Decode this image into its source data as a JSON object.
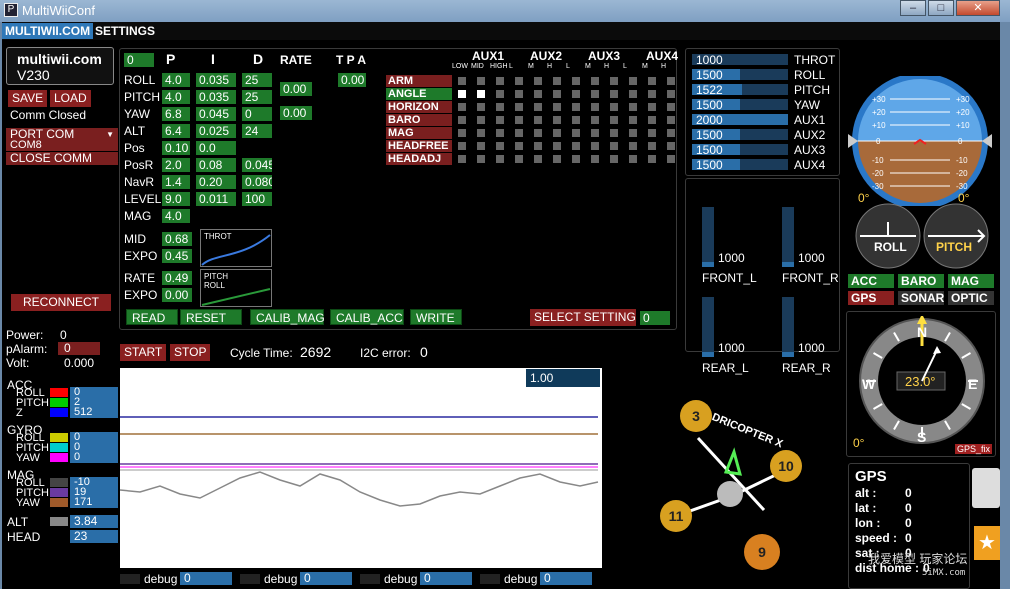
{
  "window": {
    "title": "MultiWiiConf",
    "icon": "P"
  },
  "menu": {
    "multiwii": "MULTIWII.COM",
    "settings": "SETTINGS"
  },
  "brand": {
    "line1": "multiwii.com",
    "line2": "V230"
  },
  "left": {
    "save": "SAVE",
    "load": "LOAD",
    "comm_status": "Comm Closed",
    "port_com": "PORT COM",
    "com8": "COM8",
    "close_comm": "CLOSE COMM",
    "reconnect": "RECONNECT",
    "power_label": "Power:",
    "power_val": "0",
    "palarm_label": "pAlarm:",
    "palarm_val": "0",
    "volt_label": "Volt:",
    "volt_val": "0.000"
  },
  "pid": {
    "header_num": "0",
    "col_p": "P",
    "col_i": "I",
    "col_d": "D",
    "col_rate": "RATE",
    "col_tpa": "T P A",
    "tpa_val": "0.00",
    "rows": [
      {
        "name": "ROLL",
        "p": "4.0",
        "i": "0.035",
        "d": "25"
      },
      {
        "name": "PITCH",
        "p": "4.0",
        "i": "0.035",
        "d": "25"
      },
      {
        "name": "YAW",
        "p": "6.8",
        "i": "0.045",
        "d": "0"
      },
      {
        "name": "ALT",
        "p": "6.4",
        "i": "0.025",
        "d": "24"
      },
      {
        "name": "Pos",
        "p": "0.10",
        "i": "0.0",
        "d": ""
      },
      {
        "name": "PosR",
        "p": "2.0",
        "i": "0.08",
        "d": "0.045"
      },
      {
        "name": "NavR",
        "p": "1.4",
        "i": "0.20",
        "d": "0.080"
      },
      {
        "name": "LEVEL",
        "p": "9.0",
        "i": "0.011",
        "d": "100"
      },
      {
        "name": "MAG",
        "p": "4.0",
        "i": "",
        "d": ""
      }
    ],
    "rate_roll_pitch": "0.00",
    "rate_yaw": "0.00",
    "mid_label": "MID",
    "mid_val": "0.68",
    "expo_label": "EXPO",
    "expo_val": "0.45",
    "rate_label": "RATE",
    "rate_val": "0.49",
    "expo2_label": "EXPO",
    "expo2_val": "0.00",
    "throt_graph_label": "THROT",
    "pitchroll_graph_label1": "PITCH",
    "pitchroll_graph_label2": "ROLL"
  },
  "actions": {
    "read": "READ",
    "reset": "RESET",
    "calib_mag": "CALIB_MAG",
    "calib_acc": "CALIB_ACC",
    "write": "WRITE",
    "select_setting": "SELECT SETTING",
    "setting_val": "0"
  },
  "aux": {
    "headers": [
      "AUX1",
      "AUX2",
      "AUX3",
      "AUX4"
    ],
    "sub1": [
      "LOW",
      "MID",
      "HIGH"
    ],
    "sub": [
      "L",
      "M",
      "H"
    ],
    "boxes": [
      {
        "name": "ARM",
        "active": false,
        "on": []
      },
      {
        "name": "ANGLE",
        "active": true,
        "on": [
          0,
          1
        ]
      },
      {
        "name": "HORIZON",
        "active": false,
        "on": []
      },
      {
        "name": "BARO",
        "active": false,
        "on": []
      },
      {
        "name": "MAG",
        "active": false,
        "on": []
      },
      {
        "name": "HEADFREE",
        "active": false,
        "on": []
      },
      {
        "name": "HEADADJ",
        "active": false,
        "on": []
      }
    ]
  },
  "rc": [
    {
      "name": "THROT",
      "value": "1000",
      "level": 0.0
    },
    {
      "name": "ROLL",
      "value": "1500",
      "level": 0.5
    },
    {
      "name": "PITCH",
      "value": "1522",
      "level": 0.52
    },
    {
      "name": "YAW",
      "value": "1500",
      "level": 0.5
    },
    {
      "name": "AUX1",
      "value": "2000",
      "level": 1.0
    },
    {
      "name": "AUX2",
      "value": "1500",
      "level": 0.5
    },
    {
      "name": "AUX3",
      "value": "1500",
      "level": 0.5
    },
    {
      "name": "AUX4",
      "value": "1500",
      "level": 0.5
    }
  ],
  "motors": [
    {
      "name": "FRONT_L",
      "value": "1000",
      "level": 0.08
    },
    {
      "name": "FRONT_R",
      "value": "1000",
      "level": 0.08
    },
    {
      "name": "REAR_L",
      "value": "1000",
      "level": 0.08
    },
    {
      "name": "REAR_R",
      "value": "1000",
      "level": 0.08
    }
  ],
  "horizon": {
    "ticks_pos": [
      "+30",
      "+20",
      "+10"
    ],
    "ticks_neg": [
      "-10",
      "-20",
      "-30"
    ],
    "zero": "0",
    "roll_angle": "0°",
    "pitch_angle": "0°",
    "roll_label": "ROLL",
    "pitch_label": "PITCH"
  },
  "sensors": [
    {
      "name": "ACC",
      "state": "g"
    },
    {
      "name": "BARO",
      "state": "g"
    },
    {
      "name": "MAG",
      "state": "g"
    },
    {
      "name": "GPS",
      "state": "r"
    },
    {
      "name": "SONAR",
      "state": "k"
    },
    {
      "name": "OPTIC",
      "state": "k"
    }
  ],
  "compass": {
    "n": "N",
    "s": "S",
    "e": "E",
    "w": "W",
    "heading": "23.0°",
    "zero": "0°",
    "gps_fix": "GPS_fix"
  },
  "gps": {
    "title": "GPS",
    "alt_label": "alt  :",
    "alt": "0",
    "lat_label": "lat  :",
    "lat": "0",
    "lon_label": "lon  :",
    "lon": "0",
    "speed_label": "speed :",
    "speed": "0",
    "sat_label": "sat  :",
    "sat": "0",
    "home_label": "dist home :",
    "home": "0"
  },
  "graph": {
    "start": "START",
    "stop": "STOP",
    "cycle_label": "Cycle Time:",
    "cycle_val": "2692",
    "i2c_label": "I2C error:",
    "i2c_val": "0",
    "scale": "1.00"
  },
  "quad": {
    "title": "QUADRICOPTER X",
    "m_tl": "3",
    "m_tr": "10",
    "m_bl": "11",
    "m_br": "9"
  },
  "telemetry": {
    "acc_title": "ACC",
    "acc": [
      {
        "name": "ROLL",
        "val": "0",
        "color": "#ff0000"
      },
      {
        "name": "PITCH",
        "val": "2",
        "color": "#00cc00"
      },
      {
        "name": "Z",
        "val": "512",
        "color": "#0000ff"
      }
    ],
    "gyro_title": "GYRO",
    "gyro": [
      {
        "name": "ROLL",
        "val": "0",
        "color": "#cccc00"
      },
      {
        "name": "PITCH",
        "val": "0",
        "color": "#00cccc"
      },
      {
        "name": "YAW",
        "val": "0",
        "color": "#ff00ff"
      }
    ],
    "mag_title": "MAG",
    "mag": [
      {
        "name": "ROLL",
        "val": "-10",
        "color": "#444444"
      },
      {
        "name": "PITCH",
        "val": "19",
        "color": "#6a3aa0"
      },
      {
        "name": "YAW",
        "val": "171",
        "color": "#a05a2a"
      }
    ],
    "alt_label": "ALT",
    "alt_val": "3.84",
    "alt_color": "#888888",
    "head_label": "HEAD",
    "head_val": "23",
    "head_color": "#000000"
  },
  "debug": [
    {
      "label": "debug",
      "val": "0"
    },
    {
      "label": "debug",
      "val": "0"
    },
    {
      "label": "debug",
      "val": "0"
    },
    {
      "label": "debug",
      "val": "0"
    }
  ],
  "watermark": {
    "text": "我爱模型 玩家论坛",
    "site": "5iMX.com"
  }
}
